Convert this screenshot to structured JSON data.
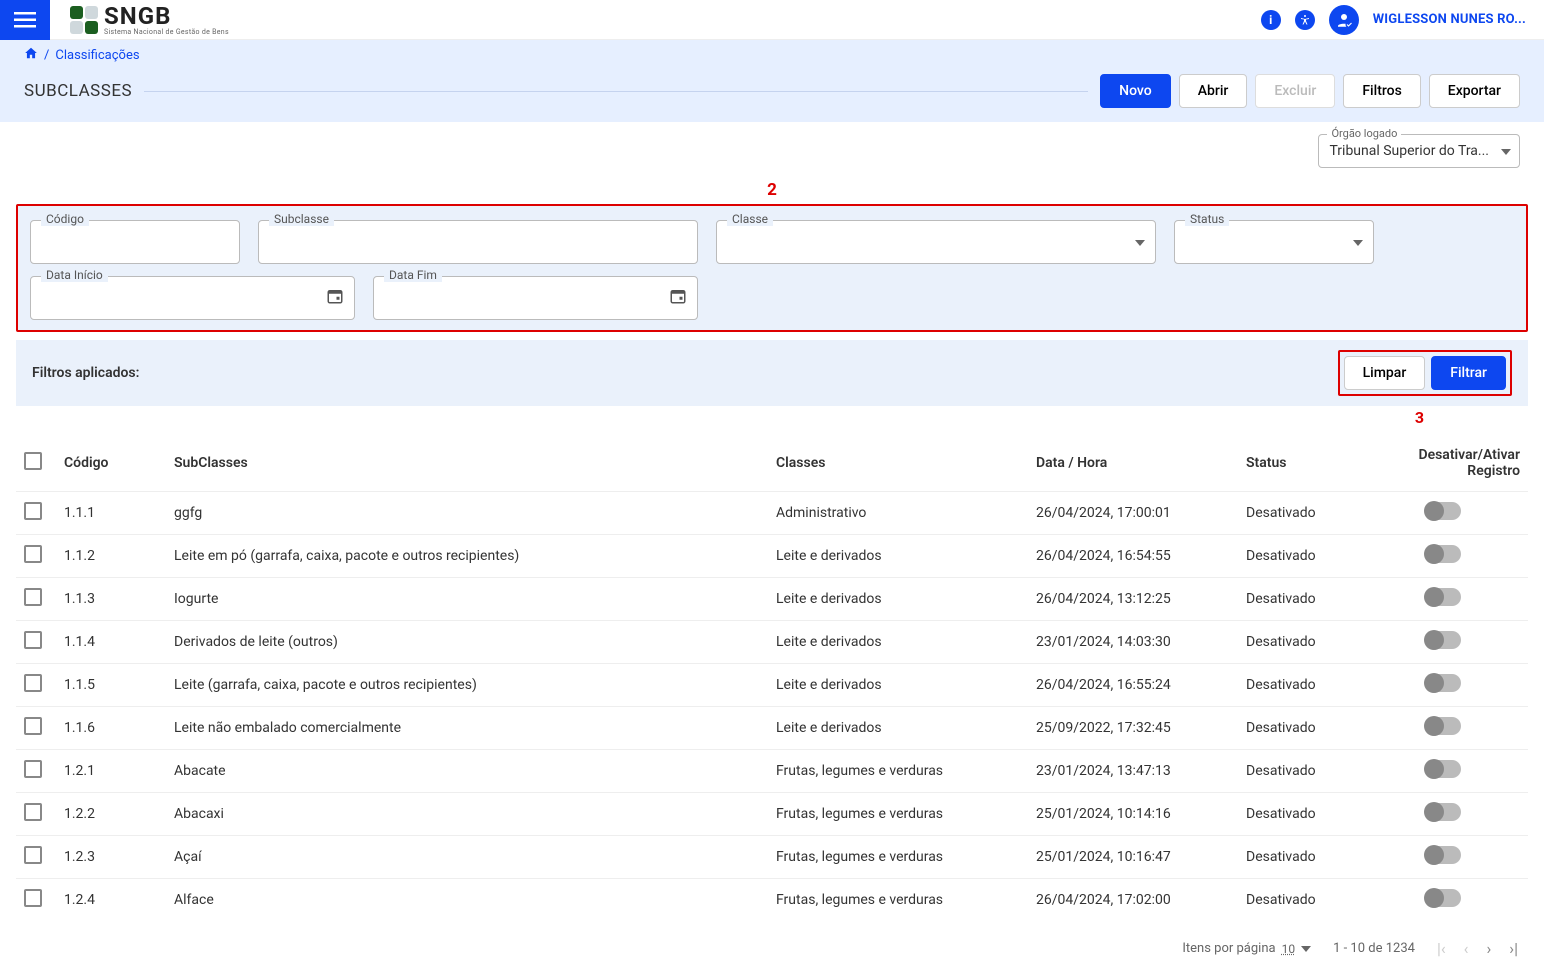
{
  "header": {
    "logo_text": "SNGB",
    "logo_sub": "Sistema Nacional de Gestão de Bens",
    "user_name": "WIGLESSON NUNES RO..."
  },
  "breadcrumb": {
    "root_icon": "home",
    "current": "Classificações"
  },
  "page": {
    "title": "SUBCLASSES"
  },
  "actions": {
    "novo": "Novo",
    "abrir": "Abrir",
    "excluir": "Excluir",
    "filtros": "Filtros",
    "exportar": "Exportar"
  },
  "orgao": {
    "label": "Órgão logado",
    "value": "Tribunal Superior do Tra..."
  },
  "callouts": {
    "filter_panel": "2",
    "filter_buttons": "3"
  },
  "filters": {
    "codigo_label": "Código",
    "subclasse_label": "Subclasse",
    "classe_label": "Classe",
    "status_label": "Status",
    "data_inicio_label": "Data Início",
    "data_fim_label": "Data Fim",
    "applied_label": "Filtros aplicados:",
    "limpar": "Limpar",
    "filtrar": "Filtrar"
  },
  "table": {
    "headers": {
      "codigo": "Código",
      "subclasses": "SubClasses",
      "classes": "Classes",
      "datahora": "Data / Hora",
      "status": "Status",
      "toggle": "Desativar/Ativar Registro"
    },
    "rows": [
      {
        "codigo": "1.1.1",
        "sub": "ggfg",
        "classe": "Administrativo",
        "data": "26/04/2024, 17:00:01",
        "status": "Desativado"
      },
      {
        "codigo": "1.1.2",
        "sub": "Leite em pó (garrafa, caixa, pacote e outros recipientes)",
        "classe": "Leite e derivados",
        "data": "26/04/2024, 16:54:55",
        "status": "Desativado"
      },
      {
        "codigo": "1.1.3",
        "sub": "Iogurte",
        "classe": "Leite e derivados",
        "data": "26/04/2024, 13:12:25",
        "status": "Desativado"
      },
      {
        "codigo": "1.1.4",
        "sub": "Derivados de leite (outros)",
        "classe": "Leite e derivados",
        "data": "23/01/2024, 14:03:30",
        "status": "Desativado"
      },
      {
        "codigo": "1.1.5",
        "sub": "Leite (garrafa, caixa, pacote e outros recipientes)",
        "classe": "Leite e derivados",
        "data": "26/04/2024, 16:55:24",
        "status": "Desativado"
      },
      {
        "codigo": "1.1.6",
        "sub": "Leite não embalado comercialmente",
        "classe": "Leite e derivados",
        "data": "25/09/2022, 17:32:45",
        "status": "Desativado"
      },
      {
        "codigo": "1.2.1",
        "sub": "Abacate",
        "classe": "Frutas, legumes e verduras",
        "data": "23/01/2024, 13:47:13",
        "status": "Desativado"
      },
      {
        "codigo": "1.2.2",
        "sub": "Abacaxi",
        "classe": "Frutas, legumes e verduras",
        "data": "25/01/2024, 10:14:16",
        "status": "Desativado"
      },
      {
        "codigo": "1.2.3",
        "sub": "Açaí",
        "classe": "Frutas, legumes e verduras",
        "data": "25/01/2024, 10:16:47",
        "status": "Desativado"
      },
      {
        "codigo": "1.2.4",
        "sub": "Alface",
        "classe": "Frutas, legumes e verduras",
        "data": "26/04/2024, 17:02:00",
        "status": "Desativado"
      }
    ]
  },
  "paginator": {
    "items_label": "Itens por página",
    "items_value": "10",
    "range": "1 - 10 de 1234"
  }
}
